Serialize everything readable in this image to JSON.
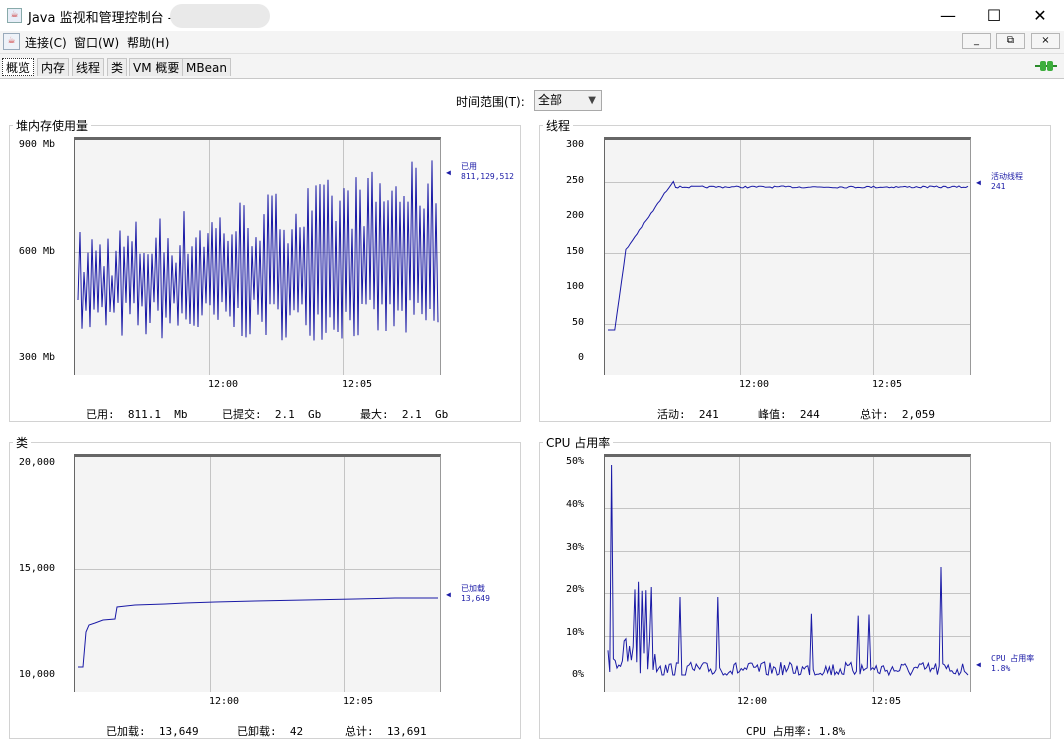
{
  "window": {
    "title": "Java 监视和管理控制台 - 3",
    "minimize_glyph": "—",
    "maximize_glyph": "☐",
    "close_glyph": "✕"
  },
  "menubar": {
    "items": [
      "连接(C)",
      "窗口(W)",
      "帮助(H)"
    ],
    "mdi_buttons": [
      "_",
      "⧉",
      "×"
    ]
  },
  "tabs": [
    "概览",
    "内存",
    "线程",
    "类",
    "VM 概要",
    "MBean"
  ],
  "selected_tab": "概览",
  "time_range": {
    "label": "时间范围(T):",
    "value": "全部"
  },
  "panels": {
    "heap": {
      "title": "堆内存使用量",
      "y_ticks": [
        "900 Mb",
        "600 Mb",
        "300 Mb"
      ],
      "x_ticks": [
        "12:00",
        "12:05"
      ],
      "legend_name": "已用",
      "legend_value": "811,129,512",
      "stats": [
        "已用:  811.1  Mb",
        "已提交:  2.1  Gb",
        "最大:  2.1  Gb"
      ]
    },
    "threads": {
      "title": "线程",
      "y_ticks": [
        "300",
        "250",
        "200",
        "150",
        "100",
        "50",
        "0"
      ],
      "x_ticks": [
        "12:00",
        "12:05"
      ],
      "legend_name": "活动线程",
      "legend_value": "241",
      "stats": [
        "活动:  241",
        "峰值:  244",
        "总计:  2,059"
      ]
    },
    "classes": {
      "title": "类",
      "y_ticks": [
        "20,000",
        "15,000",
        "10,000"
      ],
      "x_ticks": [
        "12:00",
        "12:05"
      ],
      "legend_name": "已加载",
      "legend_value": "13,649",
      "stats": [
        "已加载:  13,649",
        "已卸载:  42",
        "总计:  13,691"
      ]
    },
    "cpu": {
      "title": "CPU 占用率",
      "y_ticks": [
        "50%",
        "40%",
        "30%",
        "20%",
        "10%",
        "0%"
      ],
      "x_ticks": [
        "12:00",
        "12:05"
      ],
      "legend_name": "CPU 占用率",
      "legend_value": "1.8%",
      "stats": [
        "CPU 占用率: 1.8%"
      ]
    }
  },
  "colors": {
    "series": "#1a1aa6",
    "plot_bg": "#f4f4f4",
    "grid": "#c4c4c4"
  }
}
